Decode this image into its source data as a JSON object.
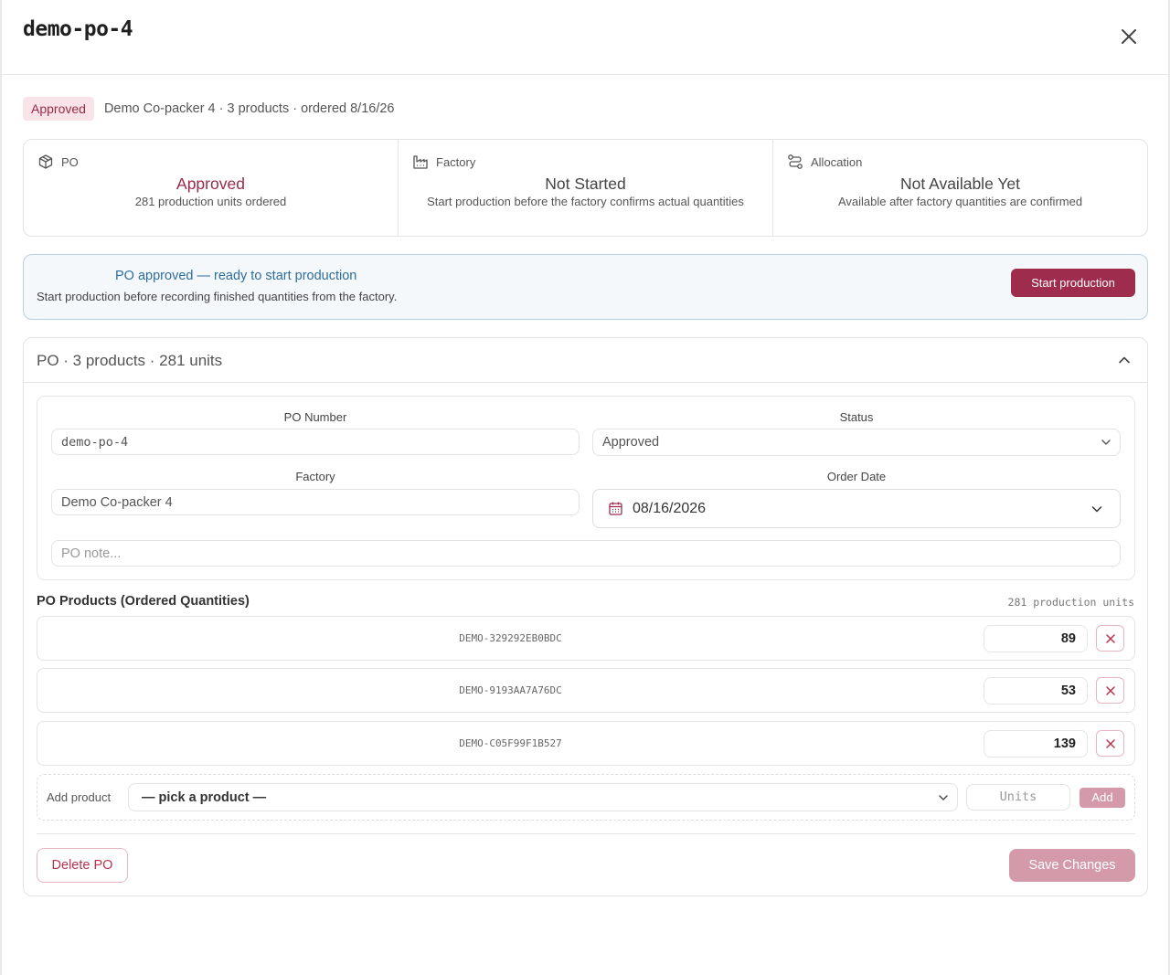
{
  "header": {
    "title": "demo-po-4"
  },
  "summary": {
    "badge": "Approved",
    "text": "Demo Co-packer 4 · 3 products · ordered 8/16/26"
  },
  "cards": [
    {
      "icon": "package-icon",
      "label": "PO",
      "status": "Approved",
      "desc": "281 production units ordered"
    },
    {
      "icon": "factory-icon",
      "label": "Factory",
      "status": "Not Started",
      "desc": "Start production before the factory confirms actual quantities"
    },
    {
      "icon": "allocation-icon",
      "label": "Allocation",
      "status": "Not Available Yet",
      "desc": "Available after factory quantities are confirmed"
    }
  ],
  "banner": {
    "title": "PO approved — ready to start production",
    "subtitle": "Start production before recording finished quantities from the factory.",
    "button": "Start production"
  },
  "section": {
    "title": "PO · 3 products · 281 units",
    "form": {
      "po_number_label": "PO Number",
      "po_number_value": "demo-po-4",
      "status_label": "Status",
      "status_value": "Approved",
      "factory_label": "Factory",
      "factory_value": "Demo Co-packer 4",
      "order_date_label": "Order Date",
      "order_date_value": "08/16/2026",
      "note_placeholder": "PO note..."
    },
    "products_title": "PO Products (Ordered Quantities)",
    "products_total": "281 production units",
    "products": [
      {
        "sku": "DEMO-329292EB0BDC",
        "qty": "89"
      },
      {
        "sku": "DEMO-9193AA7A76DC",
        "qty": "53"
      },
      {
        "sku": "DEMO-C05F99F1B527",
        "qty": "139"
      }
    ],
    "add": {
      "label": "Add product",
      "select_value": "— pick a product —",
      "units_placeholder": "Units",
      "button": "Add"
    },
    "delete_button": "Delete PO",
    "save_button": "Save Changes"
  },
  "colors": {
    "accent": "#9e2c4d",
    "accent_light": "#d49aaa",
    "info": "#2f6d9e"
  }
}
